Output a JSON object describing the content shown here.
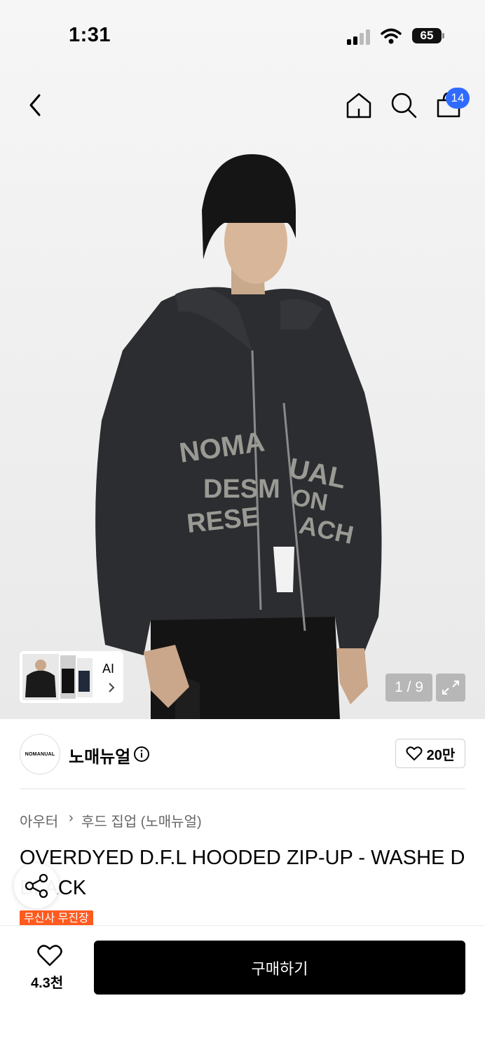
{
  "status_bar": {
    "time": "1:31",
    "battery": "65"
  },
  "nav": {
    "cart_count": "14"
  },
  "gallery": {
    "ai_label": "AI",
    "counter": "1 / 9"
  },
  "brand": {
    "logo_text": "NOMANUAL",
    "name": "노매뉴얼",
    "like_count": "20만"
  },
  "breadcrumb": {
    "level1": "아우터",
    "separator": "›",
    "level2": "후드 집업 (노매뉴얼)"
  },
  "product": {
    "title": "OVERDYED D.F.L HOODED ZIP-UP - WASHE D BLACK",
    "tag": "무신사 무진장"
  },
  "bottom_bar": {
    "like_count": "4.3천",
    "buy_label": "구매하기"
  },
  "colors": {
    "accent_blue": "#2f6bff",
    "tag_orange": "#ff5a1f",
    "buy_button": "#000000"
  },
  "icons": [
    "back-icon",
    "home-icon",
    "search-icon",
    "cart-icon",
    "chevron-right-icon",
    "expand-icon",
    "info-icon",
    "heart-icon",
    "share-icon"
  ]
}
